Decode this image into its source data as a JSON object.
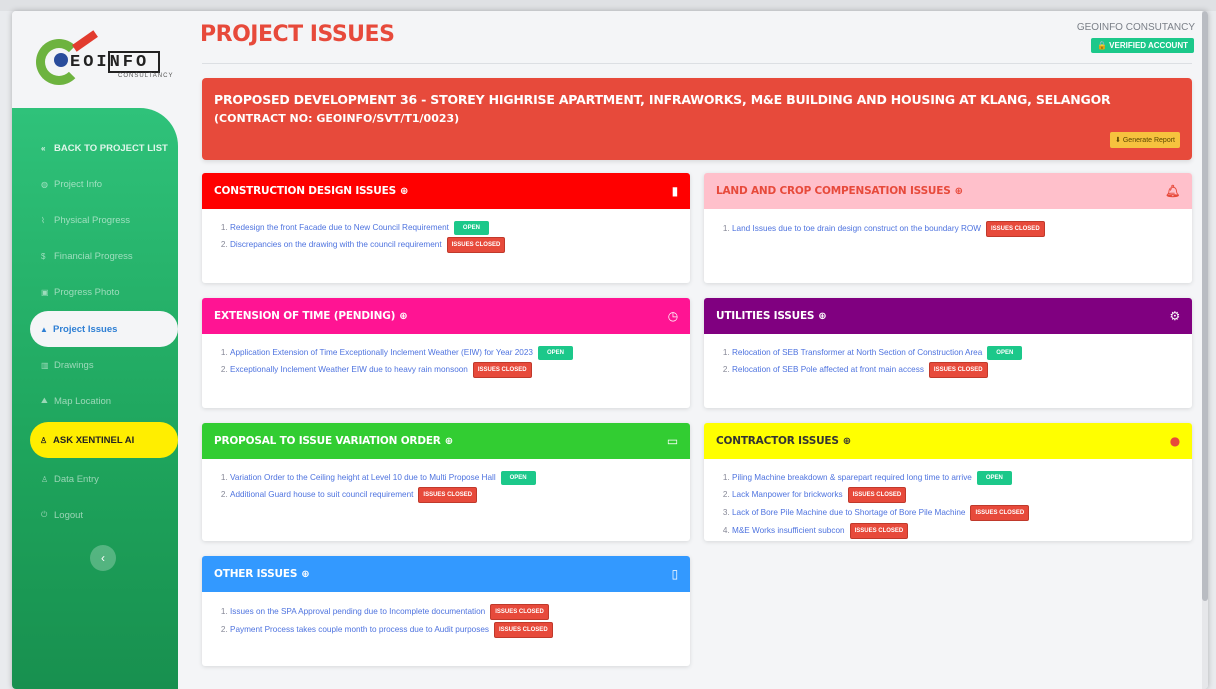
{
  "sidebar": {
    "logo_text": "EOINFO",
    "logo_sub": "CONSULTANCY",
    "items": [
      {
        "label": "BACK TO PROJECT LIST",
        "icon": "angles-left-icon",
        "glyph": "«"
      },
      {
        "label": "Project Info",
        "icon": "info-icon",
        "glyph": "◍"
      },
      {
        "label": "Physical Progress",
        "icon": "chart-line-icon",
        "glyph": "⌇"
      },
      {
        "label": "Financial Progress",
        "icon": "dollar-icon",
        "glyph": "$"
      },
      {
        "label": "Progress Photo",
        "icon": "image-icon",
        "glyph": "▣"
      },
      {
        "label": "Project Issues",
        "icon": "warning-icon",
        "glyph": "▲"
      },
      {
        "label": "Drawings",
        "icon": "map-icon",
        "glyph": "▥"
      },
      {
        "label": "Map Location",
        "icon": "map-location-icon",
        "glyph": "⛰"
      },
      {
        "label": "ASK XENTINEL AI",
        "icon": "user-secret-icon",
        "glyph": "♙"
      },
      {
        "label": "Data Entry",
        "icon": "user-icon",
        "glyph": "♙"
      },
      {
        "label": "Logout",
        "icon": "power-icon",
        "glyph": "⏻"
      }
    ],
    "collapse_glyph": "‹"
  },
  "header": {
    "title": "PROJECT ISSUES",
    "company": "GEOINFO CONSUTANCY",
    "verified": "🔒 VERIFIED ACCOUNT"
  },
  "banner": {
    "title": "PROPOSED DEVELOPMENT 36 - STOREY HIGHRISE APARTMENT, INFRAWORKS, M&E BUILDING AND HOUSING AT KLANG, SELANGOR",
    "contract": "(CONTRACT NO: GEOINFO/SVT/T1/0023)",
    "button": "⬇ Generate Report"
  },
  "badges": {
    "open": "OPEN",
    "closed": "ISSUES CLOSED"
  },
  "colors": {
    "construction": "#ff0000",
    "land": "#ffc0cb",
    "eot": "#ff1493",
    "utilities": "#800080",
    "variation": "#32cd32",
    "contractor": "#ffff00",
    "other": "#3399ff"
  },
  "cards": {
    "construction": {
      "title": "CONSTRUCTION DESIGN ISSUES",
      "icon": "map-icon",
      "items": [
        {
          "text": "Redesign the front Facade due to New Council Requirement",
          "status": "open"
        },
        {
          "text": "Discrepancies on the drawing with the council requirement",
          "status": "closed"
        }
      ]
    },
    "land": {
      "title": "LAND AND CROP COMPENSATION ISSUES",
      "icon": "bell-icon",
      "items": [
        {
          "text": "Land Issues due to toe drain design construct on the boundary ROW",
          "status": "closed"
        }
      ]
    },
    "eot": {
      "title": "EXTENSION OF TIME (PENDING)",
      "icon": "clock-icon",
      "items": [
        {
          "text": "Application Extension of Time Exceptionally Inclement Weather (EIW) for Year 2023",
          "status": "open"
        },
        {
          "text": "Exceptionally Inclement Weather EIW due to heavy rain monsoon",
          "status": "closed"
        }
      ]
    },
    "utilities": {
      "title": "UTILITIES ISSUES",
      "icon": "cogs-icon",
      "items": [
        {
          "text": "Relocation of SEB Transformer at North Section of Construction Area",
          "status": "open"
        },
        {
          "text": "Relocation of SEB Pole affected at front main access",
          "status": "closed"
        }
      ]
    },
    "variation": {
      "title": "PROPOSAL TO ISSUE VARIATION ORDER",
      "icon": "money-bill-icon",
      "items": [
        {
          "text": "Variation Order to the Ceiling height at Level 10 due to Multi Propose Hall",
          "status": "open"
        },
        {
          "text": "Additional Guard house to suit council requirement",
          "status": "closed"
        }
      ]
    },
    "contractor": {
      "title": "CONTRACTOR ISSUES",
      "icon": "user-circle-icon",
      "items": [
        {
          "text": "Piling Machine breakdown & sparepart required long time to arrive",
          "status": "open"
        },
        {
          "text": "Lack Manpower for brickworks",
          "status": "closed"
        },
        {
          "text": "Lack of Bore Pile Machine due to Shortage of Bore Pile Machine",
          "status": "closed"
        },
        {
          "text": "M&E Works insufficient subcon",
          "status": "closed"
        }
      ]
    },
    "other": {
      "title": "OTHER ISSUES",
      "icon": "file-icon",
      "items": [
        {
          "text": "Issues on the SPA Approval pending due to Incomplete documentation",
          "status": "closed"
        },
        {
          "text": "Payment Process takes couple month to process due to Audit purposes",
          "status": "closed"
        }
      ]
    }
  }
}
